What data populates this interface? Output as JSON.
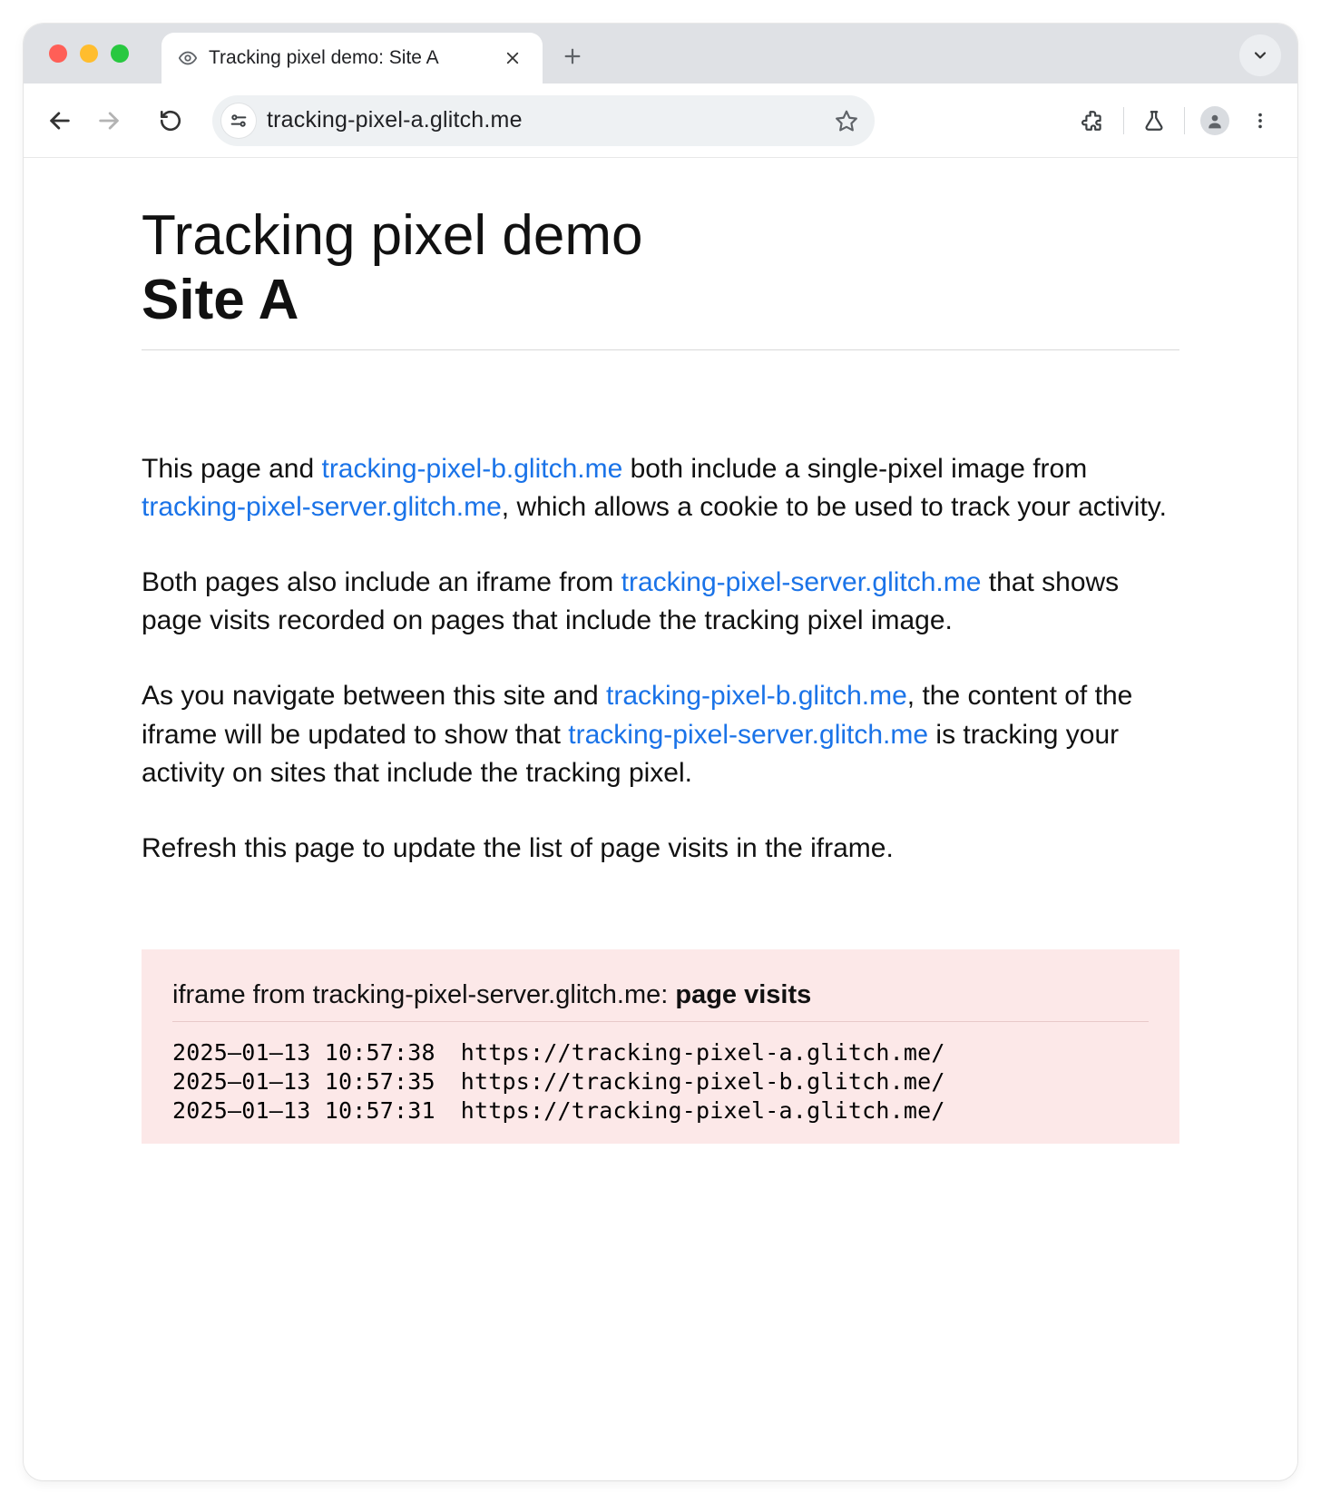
{
  "tab": {
    "title": "Tracking pixel demo: Site A"
  },
  "omnibox": {
    "url": "tracking-pixel-a.glitch.me"
  },
  "page": {
    "heading_line1": "Tracking pixel demo",
    "heading_line2": "Site A",
    "para1": {
      "t1": "This page and ",
      "link1": "tracking-pixel-b.glitch.me",
      "t2": " both include a single-pixel image from ",
      "link2": "tracking-pixel-server.glitch.me",
      "t3": ", which allows a cookie to be used to track your activity."
    },
    "para2": {
      "t1": "Both pages also include an iframe from ",
      "link1": "tracking-pixel-server.glitch.me",
      "t2": " that shows page visits recorded on pages that include the tracking pixel image."
    },
    "para3": {
      "t1": "As you navigate between this site and ",
      "link1": "tracking-pixel-b.glitch.me",
      "t2": ", the content of the iframe will be updated to show that ",
      "link2": "tracking-pixel-server.glitch.me",
      "t3": " is tracking your activity on sites that include the tracking pixel."
    },
    "para4": "Refresh this page to update the list of page visits in the iframe."
  },
  "iframe": {
    "heading_prefix": "iframe from tracking-pixel-server.glitch.me: ",
    "heading_bold": "page visits",
    "visits": [
      {
        "ts": "2025–01–13 10:57:38",
        "url": "https://tracking-pixel-a.glitch.me/"
      },
      {
        "ts": "2025–01–13 10:57:35",
        "url": "https://tracking-pixel-b.glitch.me/"
      },
      {
        "ts": "2025–01–13 10:57:31",
        "url": "https://tracking-pixel-a.glitch.me/"
      }
    ]
  }
}
